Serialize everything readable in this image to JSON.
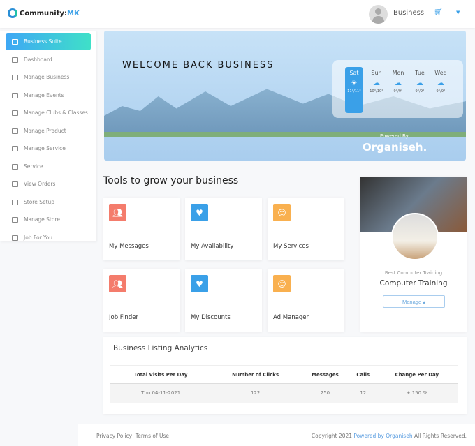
{
  "header": {
    "logo_text": "Community:",
    "logo_accent": "MK",
    "user": "Business"
  },
  "sidebar": {
    "items": [
      {
        "label": "Business Suite"
      },
      {
        "label": "Dashboard"
      },
      {
        "label": "Manage Business"
      },
      {
        "label": "Manage Events"
      },
      {
        "label": "Manage Clubs & Classes"
      },
      {
        "label": "Manage Product"
      },
      {
        "label": "Manage Service"
      },
      {
        "label": "Service"
      },
      {
        "label": "View Orders"
      },
      {
        "label": "Store Setup"
      },
      {
        "label": "Manage Store"
      },
      {
        "label": "Job For You"
      }
    ]
  },
  "banner": {
    "welcome": "WELCOME BACK BUSINESS",
    "powered_by": "Powered By:",
    "brand": "Organiseh.",
    "weather": [
      {
        "day": "Sat",
        "temp": "11°/11°"
      },
      {
        "day": "Sun",
        "temp": "10°/10°"
      },
      {
        "day": "Mon",
        "temp": "9°/9°"
      },
      {
        "day": "Tue",
        "temp": "9°/9°"
      },
      {
        "day": "Wed",
        "temp": "9°/9°"
      }
    ]
  },
  "tools": {
    "title": "Tools to grow your business",
    "cards": [
      {
        "label": "My Messages",
        "color": "#f47c6c"
      },
      {
        "label": "My Availability",
        "color": "#3aa0e8"
      },
      {
        "label": "My Services",
        "color": "#f9b04f"
      },
      {
        "label": "Job Finder",
        "color": "#f47c6c"
      },
      {
        "label": "My Discounts",
        "color": "#3aa0e8"
      },
      {
        "label": "Ad Manager",
        "color": "#f9b04f"
      }
    ]
  },
  "profile": {
    "subtitle": "Best Computer Training",
    "title": "Computer Training",
    "manage": "Manage ▴"
  },
  "analytics": {
    "title": "Business Listing Analytics",
    "columns": [
      "Total Visits Per Day",
      "Number of Clicks",
      "Messages",
      "Calls",
      "Change Per Day"
    ],
    "rows": [
      [
        "Thu   04-11-2021",
        "122",
        "250",
        "12",
        "+ 150 %"
      ]
    ]
  },
  "footer": {
    "privacy": "Privacy Policy",
    "terms": "Terms of Use",
    "copyright": "Copyright 2021",
    "powered": "Powered by Organiseh",
    "rights": "All Rights Reserved."
  }
}
